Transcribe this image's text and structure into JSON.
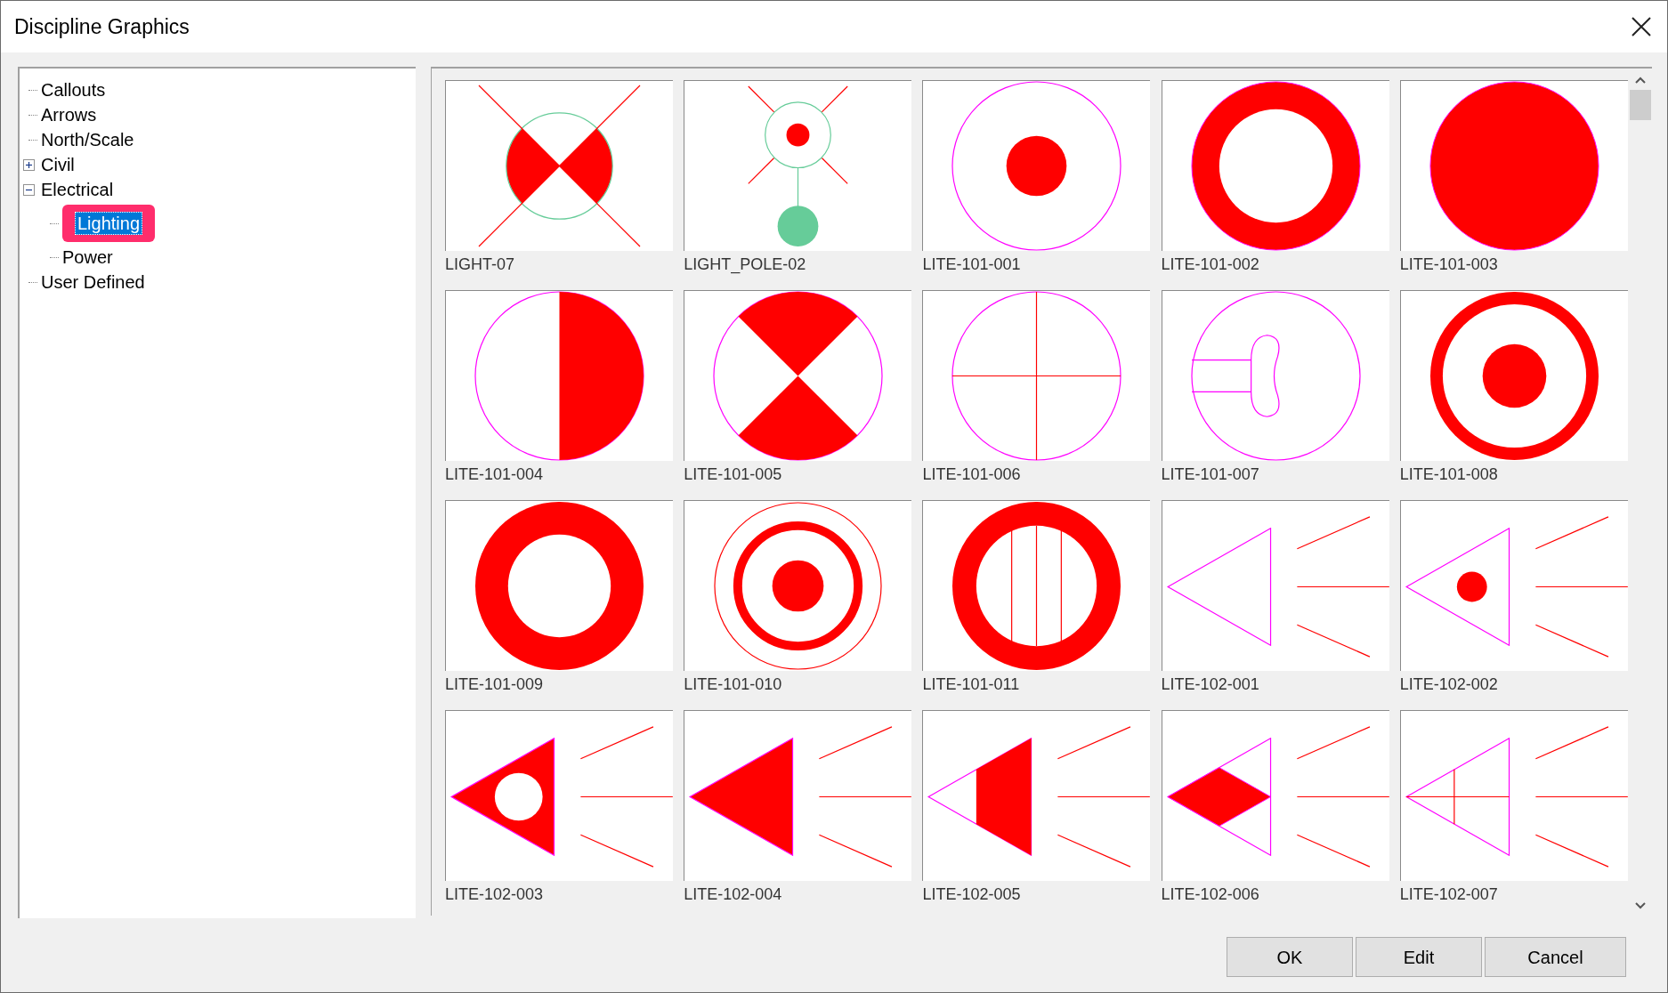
{
  "window": {
    "title": "Discipline Graphics"
  },
  "tree": [
    {
      "label": "Callouts"
    },
    {
      "label": "Arrows"
    },
    {
      "label": "North/Scale"
    },
    {
      "label": "Civil",
      "expanded": false,
      "selected": false
    },
    {
      "label": "Electrical",
      "expanded": true,
      "selected": false,
      "children": [
        {
          "label": "Lighting",
          "selected": true
        },
        {
          "label": "Power",
          "selected": false
        }
      ]
    },
    {
      "label": "User Defined"
    }
  ],
  "symbols": [
    {
      "kind": "xcircle",
      "label": "LIGHT-07"
    },
    {
      "kind": "pole",
      "label": "LIGHT_POLE-02"
    },
    {
      "kind": "dot",
      "label": "LITE-101-001"
    },
    {
      "kind": "ring",
      "label": "LITE-101-002"
    },
    {
      "kind": "disc",
      "label": "LITE-101-003"
    },
    {
      "kind": "half",
      "label": "LITE-101-004"
    },
    {
      "kind": "hourglass",
      "label": "LITE-101-005"
    },
    {
      "kind": "cross",
      "label": "LITE-101-006"
    },
    {
      "kind": "loop",
      "label": "LITE-101-007"
    },
    {
      "kind": "target",
      "label": "LITE-101-008"
    },
    {
      "kind": "thickring",
      "label": "LITE-101-009"
    },
    {
      "kind": "bullseye",
      "label": "LITE-101-010"
    },
    {
      "kind": "bars",
      "label": "LITE-101-011"
    },
    {
      "kind": "cone",
      "label": "LITE-102-001"
    },
    {
      "kind": "conedot",
      "label": "LITE-102-002"
    },
    {
      "kind": "conehole",
      "label": "LITE-102-003"
    },
    {
      "kind": "conefill",
      "label": "LITE-102-004"
    },
    {
      "kind": "conehalf",
      "label": "LITE-102-005"
    },
    {
      "kind": "conediamond",
      "label": "LITE-102-006"
    },
    {
      "kind": "conecross",
      "label": "LITE-102-007"
    }
  ],
  "buttons": [
    "OK",
    "Edit",
    "Cancel"
  ]
}
